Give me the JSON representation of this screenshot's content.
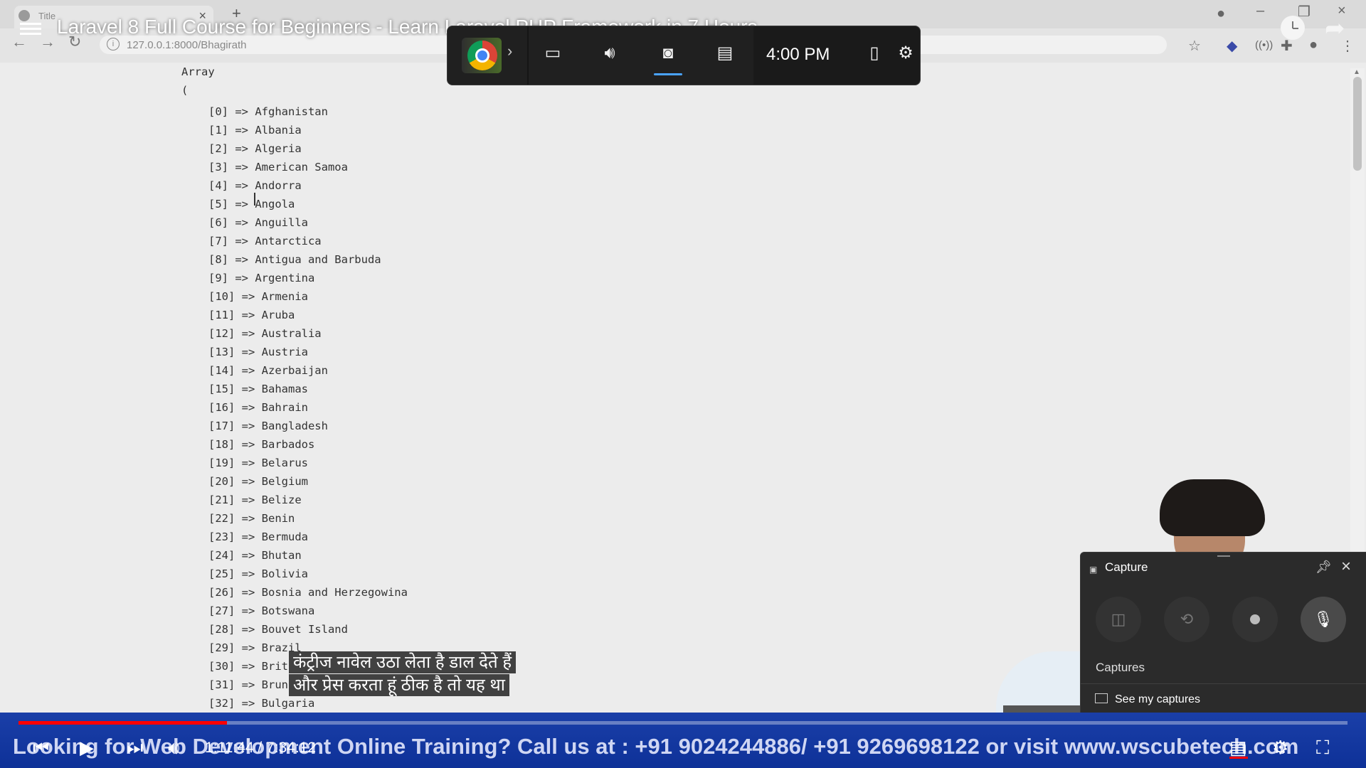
{
  "browser": {
    "tab_title": "Title",
    "url": "127.0.0.1:8000/Bhagirath"
  },
  "video": {
    "title": "Laravel 8 Full Course for Beginners - Learn Laravel PHP Framework in 7 Hours",
    "time": "1:11:44 / 7:34:12",
    "progress_fraction": 0.157,
    "ticker": "Looking for Web Development Online Training? Call us at : +91 9024244886/ +91 9269698122 or visit www.wscubetech.com"
  },
  "array_output": {
    "title": "Array",
    "open": "(",
    "items": [
      "[0] => Afghanistan",
      "[1] => Albania",
      "[2] => Algeria",
      "[3] => American Samoa",
      "[4] => Andorra",
      "[5] => Angola",
      "[6] => Anguilla",
      "[7] => Antarctica",
      "[8] => Antigua and Barbuda",
      "[9] => Argentina",
      "[10] => Armenia",
      "[11] => Aruba",
      "[12] => Australia",
      "[13] => Austria",
      "[14] => Azerbaijan",
      "[15] => Bahamas",
      "[16] => Bahrain",
      "[17] => Bangladesh",
      "[18] => Barbados",
      "[19] => Belarus",
      "[20] => Belgium",
      "[21] => Belize",
      "[22] => Benin",
      "[23] => Bermuda",
      "[24] => Bhutan",
      "[25] => Bolivia",
      "[26] => Bosnia and Herzegowina",
      "[27] => Botswana",
      "[28] => Bouvet Island",
      "[29] => Brazil",
      "[30] => Brit",
      "[31] => Brun",
      "[32] => Bulgaria"
    ]
  },
  "game_bar": {
    "time": "4:00 PM"
  },
  "capture": {
    "title": "Capture",
    "captures_label": "Captures",
    "see_captures": "See my captures"
  },
  "subtitles": {
    "line1": "कंट्रीज नावेल उठा लेता है डाल देते हैं",
    "line2": "और प्रेस करता हूं ठीक है तो यह था"
  }
}
